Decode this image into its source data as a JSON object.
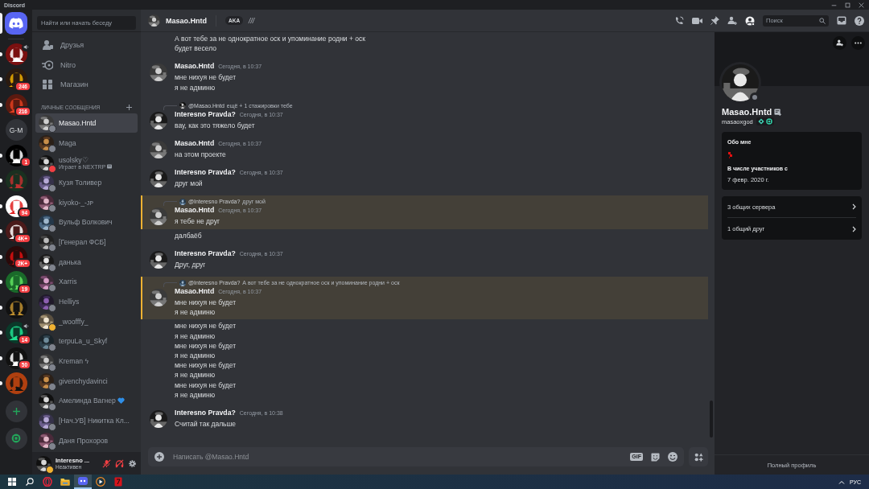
{
  "window": {
    "title": "Discord"
  },
  "home": {
    "selected": true
  },
  "servers": [
    {
      "kind": "picture",
      "unread": true,
      "voice": true
    },
    {
      "kind": "picture",
      "unread": true,
      "badge": "246"
    },
    {
      "kind": "picture",
      "unread": true,
      "badge": "216"
    },
    {
      "kind": "initials",
      "label": "G-M",
      "unread": false
    },
    {
      "kind": "picture",
      "unread": true,
      "badge": "1"
    },
    {
      "kind": "picture",
      "unread": true
    },
    {
      "kind": "picture",
      "unread": true,
      "badge": "94"
    },
    {
      "kind": "picture",
      "unread": true,
      "badge": "4K+"
    },
    {
      "kind": "picture",
      "unread": true,
      "badge": "2K+"
    },
    {
      "kind": "picture",
      "unread": true,
      "badge": "19"
    },
    {
      "kind": "picture",
      "unread": true
    },
    {
      "kind": "picture",
      "unread": true,
      "voice": true,
      "badge": "14"
    },
    {
      "kind": "picture",
      "unread": true,
      "badge": "50"
    },
    {
      "kind": "picture",
      "unread": true
    }
  ],
  "sidebar": {
    "search_placeholder": "Найти или начать беседу",
    "nav": [
      {
        "kind": "friends",
        "label": "Друзья"
      },
      {
        "kind": "nitro",
        "label": "Nitro"
      },
      {
        "kind": "shop",
        "label": "Магазин"
      }
    ],
    "dm_heading": "ЛИЧНЫЕ СООБЩЕНИЯ",
    "dms": [
      {
        "name": "Masao.Hntd",
        "color": "#80848e",
        "selected": true
      },
      {
        "name": "Maga",
        "color": "#80848e",
        "selected": false
      },
      {
        "name": "usolsky♡",
        "color": "#f23f43",
        "selected": false,
        "activity": "Играет в NEXTRP"
      },
      {
        "name": "Кузя Толивер",
        "color": "#80848e",
        "selected": false
      },
      {
        "name": "kiyoko-_-ᴊᴘ",
        "color": "#80848e",
        "selected": false
      },
      {
        "name": "Вульф Волкович",
        "color": "#80848e",
        "selected": false
      },
      {
        "name": "[Генерал ФСБ]",
        "color": "#80848e",
        "selected": false
      },
      {
        "name": "данька",
        "color": "#80848e",
        "selected": false
      },
      {
        "name": "Xarris",
        "color": "#80848e",
        "selected": false
      },
      {
        "name": "Helliys",
        "color": "#80848e",
        "selected": false
      },
      {
        "name": "_woofffy_",
        "color": "#f0b232",
        "selected": false
      },
      {
        "name": "terpuLa_u_Skyf",
        "color": "#80848e",
        "selected": false
      },
      {
        "name": "Kreman ϟ",
        "color": "#80848e",
        "selected": false
      },
      {
        "name": "givenchydavinci",
        "color": "#80848e",
        "selected": false
      },
      {
        "name": "Амелинда Вагнер",
        "color": "#80848e",
        "selected": false,
        "heart": true
      },
      {
        "name": "[Нач.УВ] Никитка Кл...",
        "color": "#80848e",
        "selected": false
      },
      {
        "name": "Даня Прохоров",
        "color": "#80848e",
        "selected": false
      }
    ],
    "user_panel": {
      "name": "Interesno ...",
      "status_text": "Неактивен",
      "color": "#f0b232",
      "mic_muted": true,
      "sound_muted": true
    }
  },
  "header": {
    "name": "Masao.Hntd",
    "tag": "AKA",
    "tag_suffix": "///",
    "search_placeholder": "Поиск",
    "profile_open": true
  },
  "messages": [
    {
      "kind": "continuation",
      "highlighted": false,
      "lines": [
        "А вот тебе за не однократное оск и упоминание родни + оск",
        "будет весело"
      ]
    },
    {
      "kind": "group",
      "highlighted": false,
      "author": "Masao.Hntd",
      "time": "Сегодня, в 10:37",
      "lines": [
        "мне нихуя не будет",
        "я не админю"
      ]
    },
    {
      "kind": "group",
      "highlighted": false,
      "reply": {
        "mention": "@Masao.Hntd",
        "text": "ещё + 1 стажировки тебе"
      },
      "author": "Interesno Pravda?",
      "time": "Сегодня, в 10:37",
      "lines": [
        "вау, как это тяжело будет"
      ]
    },
    {
      "kind": "group",
      "highlighted": false,
      "author": "Masao.Hntd",
      "time": "Сегодня, в 10:37",
      "lines": [
        "на этом проекте"
      ]
    },
    {
      "kind": "group",
      "highlighted": false,
      "author": "Interesno Pravda?",
      "time": "Сегодня, в 10:37",
      "lines": [
        "друг мой"
      ]
    },
    {
      "kind": "group",
      "highlighted": true,
      "reply": {
        "mention": "@Interesno Pravda?",
        "text": "друг мой"
      },
      "author": "Masao.Hntd",
      "time": "Сегодня, в 10:37",
      "lines": [
        "я тебе не друг"
      ]
    },
    {
      "kind": "continuation",
      "highlighted": false,
      "lines": [
        "далбаёб"
      ]
    },
    {
      "kind": "group",
      "highlighted": false,
      "author": "Interesno Pravda?",
      "time": "Сегодня, в 10:37",
      "lines": [
        "Друг, друг"
      ]
    },
    {
      "kind": "group",
      "highlighted": true,
      "reply": {
        "mention": "@Interesno Pravda?",
        "text": "А вот тебе за не однократное оск и упоминание родни + оск"
      },
      "author": "Masao.Hntd",
      "time": "Сегодня, в 10:37",
      "lines": [
        "мне нихуя не будет",
        "я не админю"
      ]
    },
    {
      "kind": "continuation",
      "highlighted": false,
      "lines": [
        "мне нихуя не будет",
        "я не админю",
        "мне нихуя не будет",
        "я не админю",
        "мне нихуя не будет",
        "я не админю",
        "мне нихуя не будет",
        "я не админю"
      ]
    },
    {
      "kind": "group",
      "highlighted": false,
      "author": "Interesno Pravda?",
      "time": "Сегодня, в 10:38",
      "lines": [
        "Считай так дальше"
      ]
    }
  ],
  "composer": {
    "placeholder": "Написать @Masao.Hntd",
    "gif_label": "GIF"
  },
  "profile": {
    "display_name": "Masao.Hntd",
    "username": "masaoxgod",
    "color": "#80848e",
    "about_heading": "Обо мне",
    "member_since_heading": "В числе участников с",
    "member_since": "7 февр. 2020 г.",
    "links": [
      "3 общих сервера",
      "1 общий друг"
    ],
    "full_profile": "Полный профиль"
  },
  "taskbar": {
    "apps": [
      {
        "kind": "opera",
        "active": false
      },
      {
        "kind": "folder",
        "active": false
      },
      {
        "kind": "discord",
        "active": true
      },
      {
        "kind": "player",
        "active": false
      },
      {
        "kind": "red",
        "active": false
      }
    ],
    "language": "РУС"
  }
}
